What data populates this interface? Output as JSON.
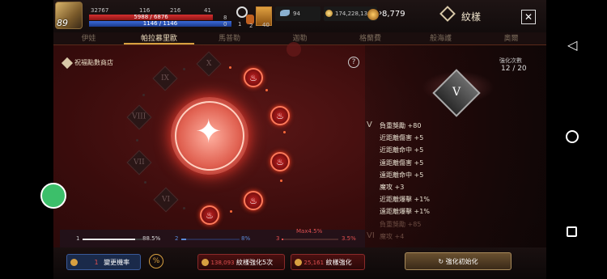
{
  "player": {
    "level": "89",
    "bp": "32767",
    "hp": "5988 / 6876",
    "hp_fraction": 0.87,
    "mp": "1146 / 1146",
    "mp_fraction": 1.0,
    "stat1": "116",
    "stat2": "216",
    "stat3": "41",
    "hp_side": "8",
    "mp_side": "0"
  },
  "buffs": {
    "b1": "1",
    "b2": "2",
    "b3": "40"
  },
  "currency": {
    "gems": "94",
    "gold": "174,228,134",
    "crystals": "8,779"
  },
  "page_title": "紋樣",
  "tabs": [
    "伊娃",
    "帕拉慕里歐",
    "馬普勒",
    "迦勒",
    "格蘭費",
    "般海護",
    "奧爾"
  ],
  "shop_label": "祝福點數商店",
  "enhance": {
    "label": "強化次數",
    "count": "12 / 20"
  },
  "emblem_label": "V",
  "tier_roman": {
    "t10": "X",
    "t9": "IX",
    "t8": "VIII",
    "t7": "VII",
    "t6": "VI"
  },
  "stats": [
    {
      "roman": "V",
      "text": "負重獎勵 +80"
    },
    {
      "roman": "",
      "text": "近距離傷害 +5"
    },
    {
      "roman": "",
      "text": "近距離命中 +5"
    },
    {
      "roman": "",
      "text": "遠距離傷害 +5"
    },
    {
      "roman": "",
      "text": "遠距離命中 +5"
    },
    {
      "roman": "",
      "text": "魔攻 +3"
    },
    {
      "roman": "",
      "text": "近距離爆擊 +1%"
    },
    {
      "roman": "",
      "text": "遠距離爆擊 +1%"
    },
    {
      "roman": "",
      "text": "負重獎勵 +85"
    },
    {
      "roman": "VI",
      "text": "魔攻 +4"
    }
  ],
  "probabilities": {
    "p1_label": "1",
    "p1_value": "88.5%",
    "p1_fraction": 0.885,
    "p2_label": "2",
    "p2_value": "8%",
    "p2_fraction": 0.08,
    "p3_label": "3",
    "p3_value": "3.5%",
    "p3_fraction": 0.035,
    "max_label": "Max4.5%"
  },
  "buttons": {
    "change_label": "變更機率",
    "change_count": "1",
    "enhance5_cost": "138,093",
    "enhance5_label": "紋樣強化5次",
    "enhance_cost": "25,161",
    "enhance_label": "紋樣強化",
    "reset_label": "強化初始化"
  },
  "help": "?"
}
